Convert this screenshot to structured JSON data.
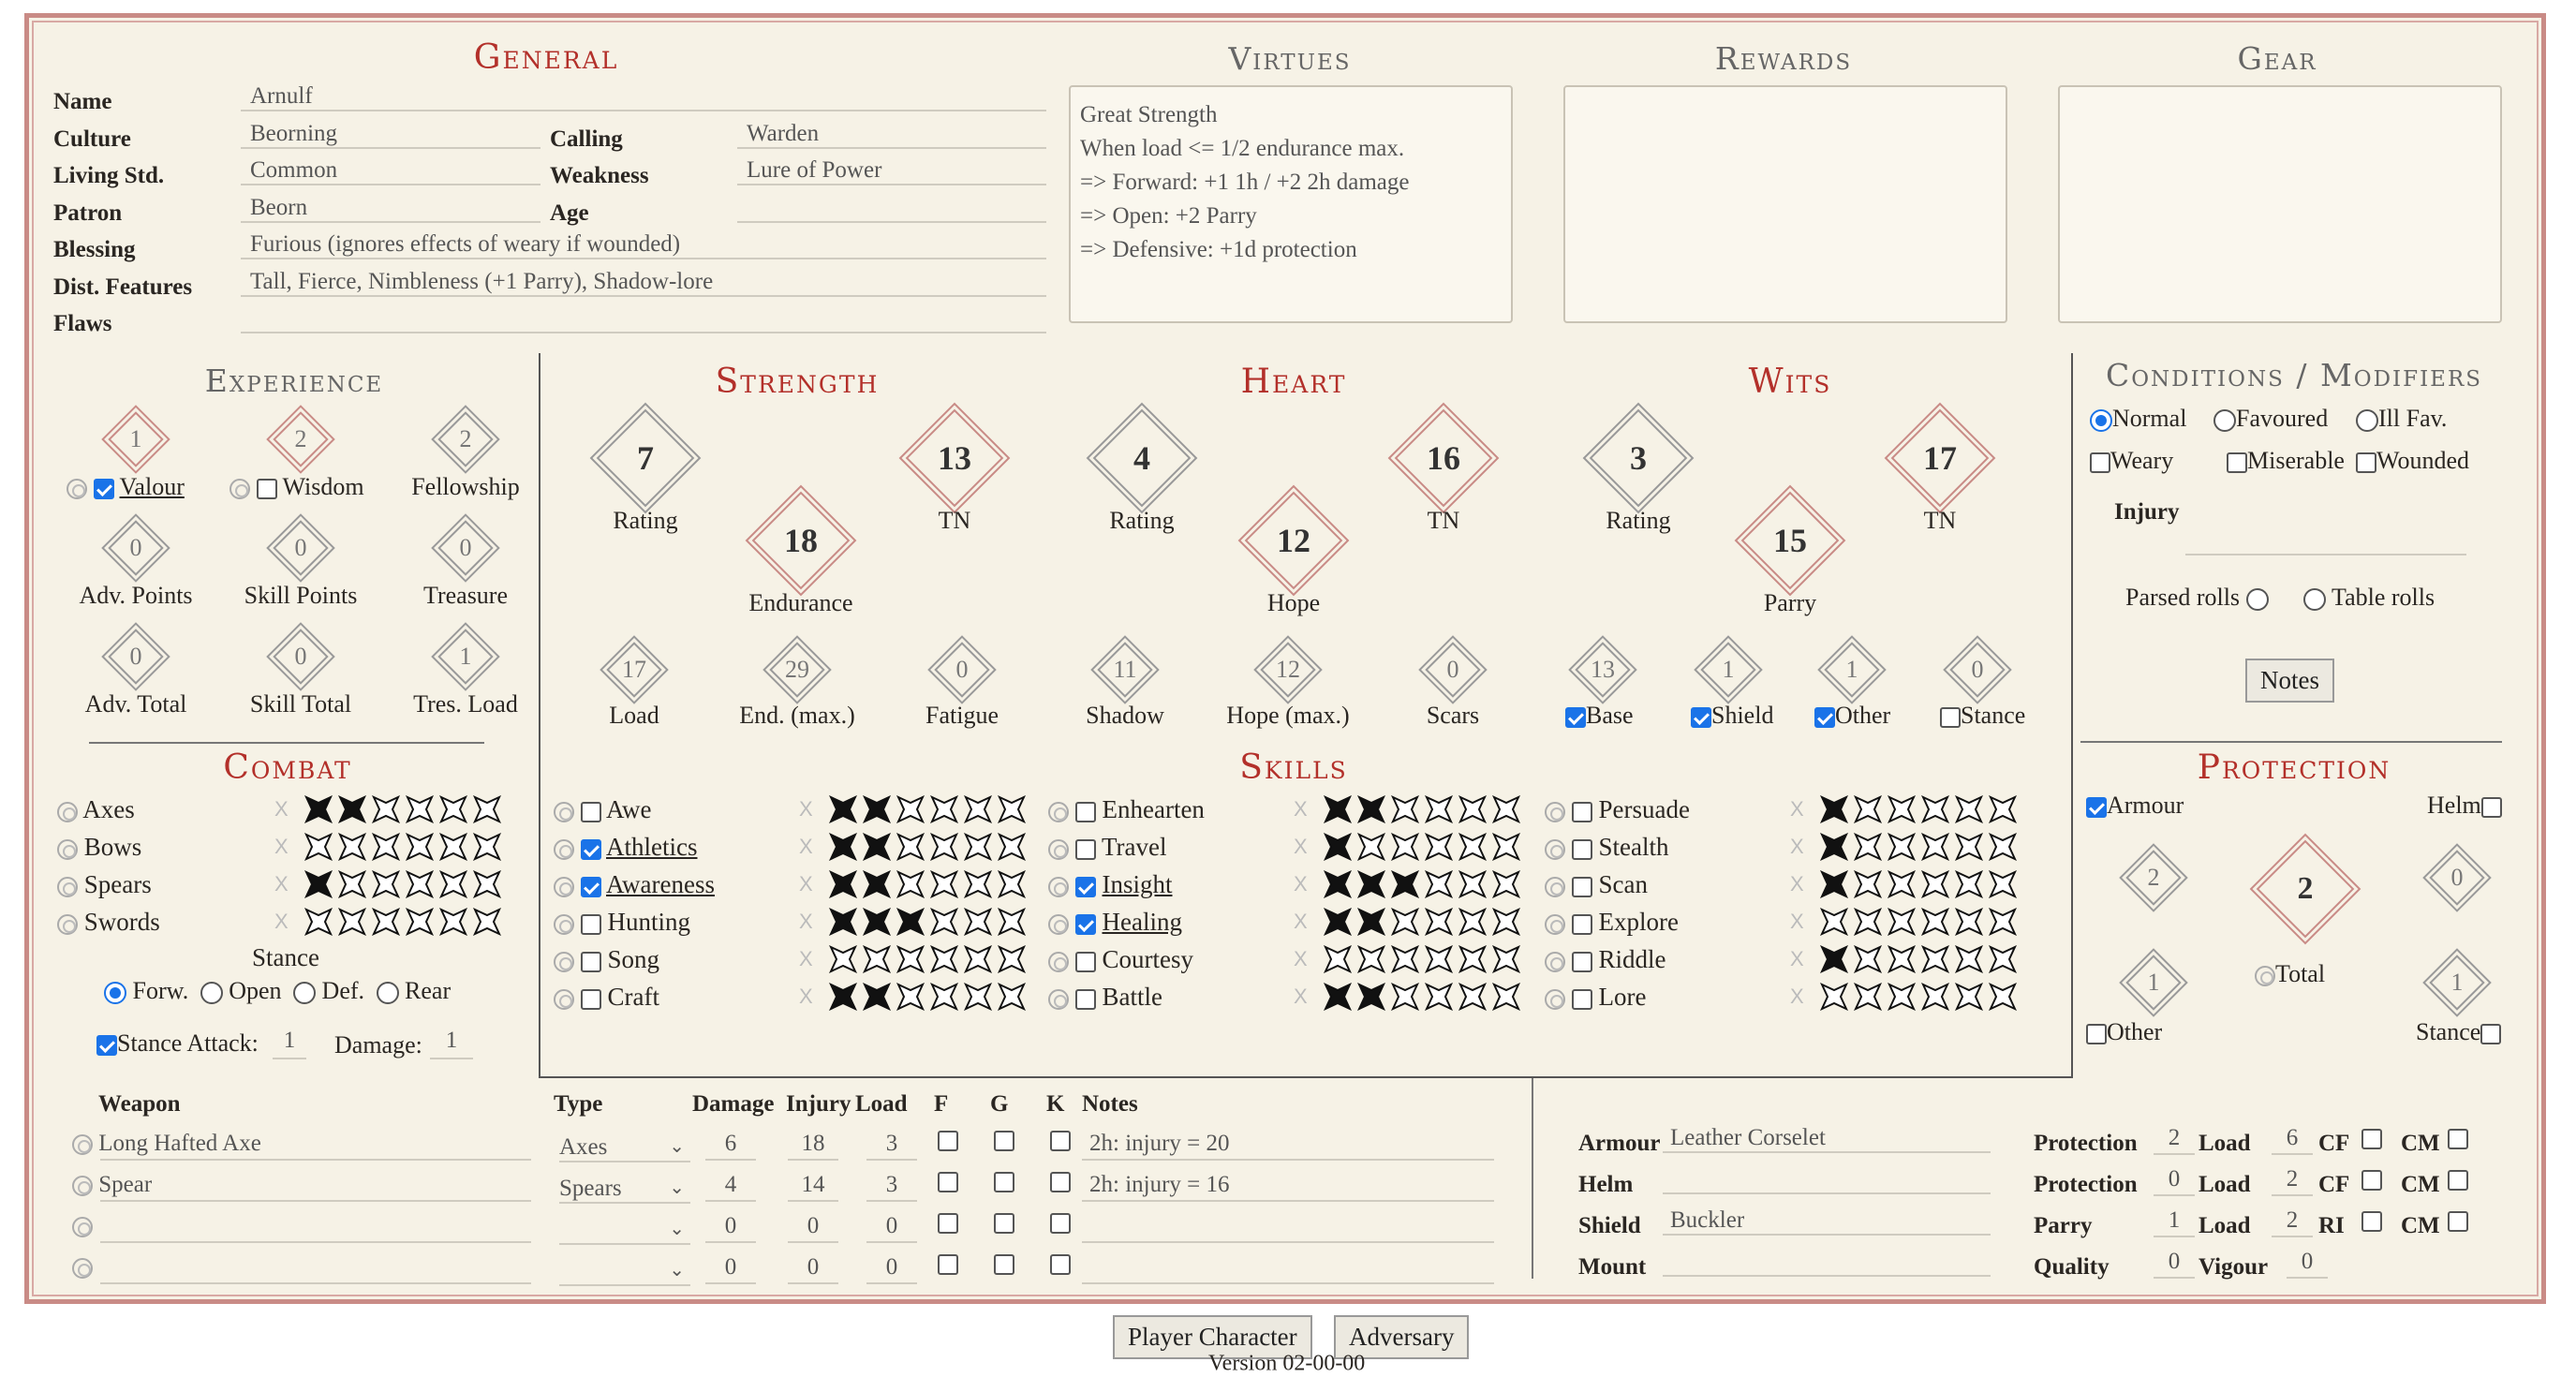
{
  "general": {
    "title": "General",
    "name_label": "Name",
    "name": "Arnulf",
    "culture_label": "Culture",
    "culture": "Beorning",
    "calling_label": "Calling",
    "calling": "Warden",
    "living_label": "Living Std.",
    "living": "Common",
    "weakness_label": "Weakness",
    "weakness": "Lure of Power",
    "patron_label": "Patron",
    "patron": "Beorn",
    "age_label": "Age",
    "age": "",
    "blessing_label": "Blessing",
    "blessing": "Furious (ignores effects of weary if wounded)",
    "features_label": "Dist. Features",
    "features": "Tall, Fierce, Nimbleness (+1 Parry), Shadow-lore",
    "flaws_label": "Flaws",
    "flaws": ""
  },
  "virtues": {
    "title": "Virtues",
    "text": "Great Strength\nWhen load <= 1/2 endurance max.\n=> Forward: +1 1h / +2 2h damage\n=> Open: +2 Parry\n=> Defensive: +1d protection"
  },
  "rewards": {
    "title": "Rewards",
    "text": ""
  },
  "gear": {
    "title": "Gear",
    "text": ""
  },
  "experience": {
    "title": "Experience",
    "valour": "1",
    "valour_label": "Valour",
    "wisdom": "2",
    "wisdom_label": "Wisdom",
    "fellowship": "2",
    "fellowship_label": "Fellowship",
    "adv_points": "0",
    "adv_points_label": "Adv. Points",
    "skill_points": "0",
    "skill_points_label": "Skill Points",
    "treasure": "0",
    "treasure_label": "Treasure",
    "adv_total": "0",
    "adv_total_label": "Adv. Total",
    "skill_total": "0",
    "skill_total_label": "Skill Total",
    "tres_load": "1",
    "tres_load_label": "Tres. Load"
  },
  "attributes": {
    "strength_title": "Strength",
    "heart_title": "Heart",
    "wits_title": "Wits",
    "str_rating": "7",
    "str_tn": "13",
    "str_end": "18",
    "heart_rating": "4",
    "heart_tn": "16",
    "heart_hope": "12",
    "wits_rating": "3",
    "wits_tn": "17",
    "wits_parry": "15",
    "rating_label": "Rating",
    "tn_label": "TN",
    "endurance_label": "Endurance",
    "hope_label": "Hope",
    "parry_label": "Parry"
  },
  "derived": {
    "load": "17",
    "load_label": "Load",
    "end_max": "29",
    "end_max_label": "End. (max.)",
    "fatigue": "0",
    "fatigue_label": "Fatigue",
    "shadow": "11",
    "shadow_label": "Shadow",
    "hope_max": "12",
    "hope_max_label": "Hope (max.)",
    "scars": "0",
    "scars_label": "Scars",
    "base": "13",
    "base_label": "Base",
    "shield": "1",
    "shield_label": "Shield",
    "other": "1",
    "other_label": "Other",
    "stance": "0",
    "stance_label": "Stance"
  },
  "conditions": {
    "title": "Conditions / Modifiers",
    "normal": "Normal",
    "favoured": "Favoured",
    "ill": "Ill Fav.",
    "weary": "Weary",
    "miserable": "Miserable",
    "wounded": "Wounded",
    "injury_label": "Injury",
    "injury": "",
    "parsed": "Parsed rolls",
    "table": "Table rolls",
    "notes_btn": "Notes"
  },
  "combat": {
    "title": "Combat",
    "skills": [
      {
        "name": "Axes",
        "rank": 2
      },
      {
        "name": "Bows",
        "rank": 0
      },
      {
        "name": "Spears",
        "rank": 1
      },
      {
        "name": "Swords",
        "rank": 0
      }
    ],
    "stance_label": "Stance",
    "forw": "Forw.",
    "open": "Open",
    "def": "Def.",
    "rear": "Rear",
    "stance_attack": "Stance Attack:",
    "stance_attack_val": "1",
    "damage_label": "Damage:",
    "damage_val": "1"
  },
  "skills": {
    "title": "Skills",
    "col1": [
      {
        "name": "Awe",
        "rank": 2,
        "fav": false
      },
      {
        "name": "Athletics",
        "rank": 2,
        "fav": true
      },
      {
        "name": "Awareness",
        "rank": 2,
        "fav": true
      },
      {
        "name": "Hunting",
        "rank": 3,
        "fav": false
      },
      {
        "name": "Song",
        "rank": 0,
        "fav": false
      },
      {
        "name": "Craft",
        "rank": 2,
        "fav": false
      }
    ],
    "col2": [
      {
        "name": "Enhearten",
        "rank": 2,
        "fav": false
      },
      {
        "name": "Travel",
        "rank": 1,
        "fav": false
      },
      {
        "name": "Insight",
        "rank": 3,
        "fav": true
      },
      {
        "name": "Healing",
        "rank": 2,
        "fav": true
      },
      {
        "name": "Courtesy",
        "rank": 0,
        "fav": false
      },
      {
        "name": "Battle",
        "rank": 2,
        "fav": false
      }
    ],
    "col3": [
      {
        "name": "Persuade",
        "rank": 1,
        "fav": false
      },
      {
        "name": "Stealth",
        "rank": 1,
        "fav": false
      },
      {
        "name": "Scan",
        "rank": 1,
        "fav": false
      },
      {
        "name": "Explore",
        "rank": 0,
        "fav": false
      },
      {
        "name": "Riddle",
        "rank": 1,
        "fav": false
      },
      {
        "name": "Lore",
        "rank": 0,
        "fav": false
      }
    ]
  },
  "protection": {
    "title": "Protection",
    "armour_label": "Armour",
    "helm_label": "Helm",
    "armour": "2",
    "total": "2",
    "helm": "0",
    "other": "1",
    "stance": "1",
    "total_label": "Total",
    "other_label": "Other",
    "stance_label": "Stance"
  },
  "weapons": {
    "h_weapon": "Weapon",
    "h_type": "Type",
    "h_damage": "Damage",
    "h_injury": "Injury",
    "h_load": "Load",
    "h_f": "F",
    "h_g": "G",
    "h_k": "K",
    "h_notes": "Notes",
    "rows": [
      {
        "name": "Long Hafted Axe",
        "type": "Axes",
        "damage": "6",
        "injury": "18",
        "load": "3",
        "notes": "2h: injury = 20"
      },
      {
        "name": "Spear",
        "type": "Spears",
        "damage": "4",
        "injury": "14",
        "load": "3",
        "notes": "2h: injury = 16"
      },
      {
        "name": "",
        "type": "",
        "damage": "0",
        "injury": "0",
        "load": "0",
        "notes": ""
      },
      {
        "name": "",
        "type": "",
        "damage": "0",
        "injury": "0",
        "load": "0",
        "notes": ""
      }
    ]
  },
  "armour": {
    "armour_label": "Armour",
    "armour": "Leather Corselet",
    "helm_label": "Helm",
    "helm": "",
    "shield_label": "Shield",
    "shield": "Buckler",
    "mount_label": "Mount",
    "mount": "",
    "prot_label": "Protection",
    "prot1": "2",
    "prot2": "0",
    "load_label": "Load",
    "load1": "6",
    "load2": "2",
    "load3": "2",
    "parry_label": "Parry",
    "parry": "1",
    "quality_label": "Quality",
    "quality": "0",
    "vigour_label": "Vigour",
    "vigour": "0",
    "cf": "CF",
    "cm": "CM",
    "ri": "RI"
  },
  "footer": {
    "player_btn": "Player Character",
    "adversary_btn": "Adversary",
    "version": "Version 02-00-00"
  }
}
